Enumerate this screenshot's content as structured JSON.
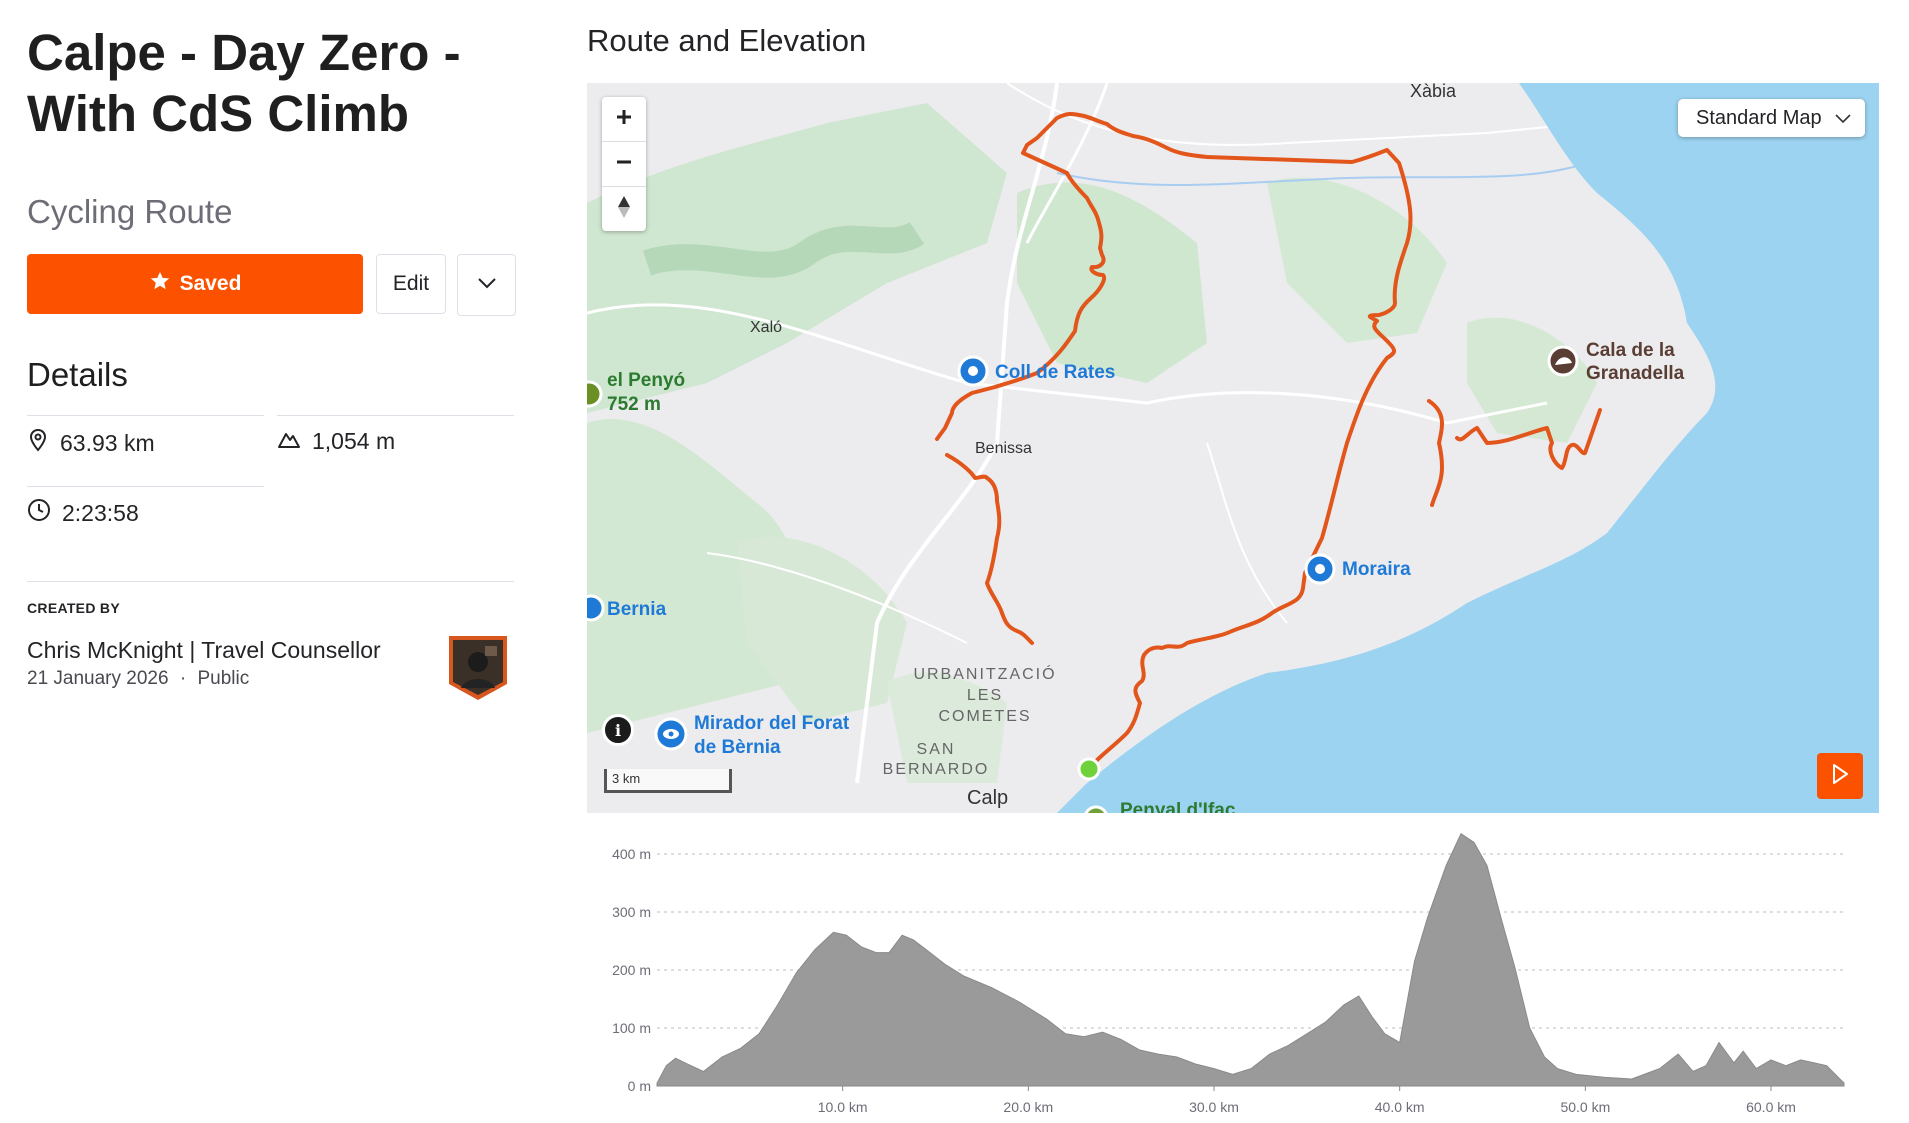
{
  "route": {
    "title": "Calpe - Day Zero - With CdS Climb",
    "type": "Cycling Route"
  },
  "actions": {
    "saved_label": "Saved",
    "edit_label": "Edit"
  },
  "details": {
    "heading": "Details",
    "distance": "63.93 km",
    "elevation_gain": "1,054 m",
    "moving_time": "2:23:58"
  },
  "creator": {
    "label": "CREATED BY",
    "name": "Chris McKnight | Travel Counsellor",
    "date": "21 January 2026",
    "separator": "·",
    "visibility": "Public"
  },
  "map": {
    "section_title": "Route and Elevation",
    "map_type": "Standard Map",
    "scale_label": "3 km",
    "route_color": "#e2561c",
    "labels": {
      "xabia": "Xàbia",
      "xalo": "Xaló",
      "penyo_1": "el Penyó",
      "penyo_2": "752 m",
      "coll_de_rates": "Coll de Rates",
      "benissa": "Benissa",
      "cala_1": "Cala de la",
      "cala_2": "Granadella",
      "moraira": "Moraira",
      "bernia": "Bernia",
      "urb_1": "URBANITZACIÓ",
      "urb_2": "LES",
      "urb_3": "COMETES",
      "mirador_1": "Mirador del Forat",
      "mirador_2": "de Bèrnia",
      "sanb_1": "SAN",
      "sanb_2": "BERNARDO",
      "calp": "Calp",
      "penyal": "Penyal d'Ifac"
    },
    "icons": {
      "zoom_in": "plus-icon",
      "zoom_out": "minus-icon",
      "compass": "compass-icon",
      "info": "info-icon",
      "play": "play-icon",
      "camera": "camera-pin-icon",
      "viewpoint": "eye-pin-icon",
      "beach": "beach-pin-icon"
    }
  },
  "chart_data": {
    "type": "area",
    "title": "",
    "xlabel": "",
    "ylabel": "",
    "x_unit": "km",
    "y_unit": "m",
    "xlim": [
      0,
      63.93
    ],
    "ylim": [
      0,
      400
    ],
    "x_ticks": [
      "10.0 km",
      "20.0 km",
      "30.0 km",
      "40.0 km",
      "50.0 km",
      "60.0 km"
    ],
    "y_ticks": [
      "0 m",
      "100 m",
      "200 m",
      "300 m",
      "400 m"
    ],
    "grid": true,
    "color": "#9a9a9a",
    "x": [
      0,
      0.5,
      1,
      1.5,
      2.5,
      3.5,
      4.5,
      5.5,
      6.5,
      7.5,
      8.5,
      9.5,
      10.2,
      11,
      11.8,
      12.5,
      13.2,
      13.8,
      14.5,
      15.5,
      16.5,
      18,
      19.5,
      21,
      22,
      23,
      24,
      25,
      26,
      27,
      28,
      29,
      30,
      31,
      32,
      33,
      34,
      35,
      36,
      37,
      37.8,
      38.5,
      39.2,
      40,
      40.8,
      41.5,
      42.5,
      43.3,
      44,
      44.7,
      45.5,
      46.2,
      47,
      47.8,
      48.5,
      49.5,
      51,
      52.5,
      54,
      55,
      55.8,
      56.5,
      57.2,
      58,
      58.5,
      59.2,
      60,
      60.8,
      61.6,
      62.3,
      63,
      63.93
    ],
    "values": [
      5,
      35,
      48,
      40,
      25,
      50,
      65,
      90,
      140,
      195,
      235,
      265,
      260,
      240,
      230,
      230,
      260,
      252,
      235,
      210,
      190,
      170,
      145,
      115,
      90,
      85,
      93,
      80,
      62,
      55,
      50,
      38,
      30,
      20,
      30,
      55,
      70,
      90,
      110,
      140,
      155,
      120,
      90,
      75,
      215,
      290,
      380,
      435,
      420,
      380,
      285,
      205,
      100,
      50,
      30,
      20,
      15,
      12,
      30,
      55,
      25,
      35,
      75,
      40,
      60,
      30,
      45,
      35,
      45,
      40,
      35,
      5
    ]
  }
}
